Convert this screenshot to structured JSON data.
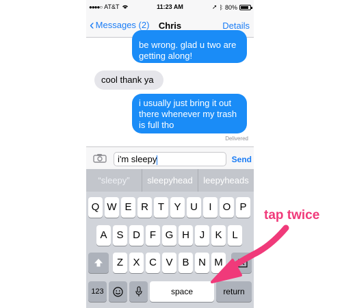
{
  "status_bar": {
    "carrier": "AT&T",
    "time": "11:23 AM",
    "battery": "80%"
  },
  "nav": {
    "back_label": "Messages (2)",
    "title": "Chris",
    "details_label": "Details"
  },
  "messages": [
    {
      "direction": "out",
      "text": "be wrong. glad u two are getting along!"
    },
    {
      "direction": "in",
      "text": "cool thank ya"
    },
    {
      "direction": "out",
      "text": "i usually just bring it out there whenever my trash is full tho"
    }
  ],
  "delivered_label": "Delivered",
  "input": {
    "value": "i'm sleepy",
    "send_label": "Send"
  },
  "predictions": [
    "“sleepy”",
    "sleepyhead",
    "leepyheads"
  ],
  "keyboard": {
    "row1": [
      "Q",
      "W",
      "E",
      "R",
      "T",
      "Y",
      "U",
      "I",
      "O",
      "P"
    ],
    "row2": [
      "A",
      "S",
      "D",
      "F",
      "G",
      "H",
      "J",
      "K",
      "L"
    ],
    "row3": [
      "Z",
      "X",
      "C",
      "V",
      "B",
      "N",
      "M"
    ],
    "numbers_label": "123",
    "space_label": "space",
    "return_label": "return"
  },
  "icons": {
    "shift": "shift-icon",
    "delete": "backspace-icon",
    "emoji": "emoji-icon",
    "mic": "microphone-icon",
    "camera": "camera-icon"
  },
  "annotation": {
    "text": "tap twice",
    "color": "#f03a7a"
  },
  "colors": {
    "accent": "#1a7cf5",
    "outgoing_bubble": "#1a8cf7",
    "incoming_bubble": "#e5e5ea"
  }
}
